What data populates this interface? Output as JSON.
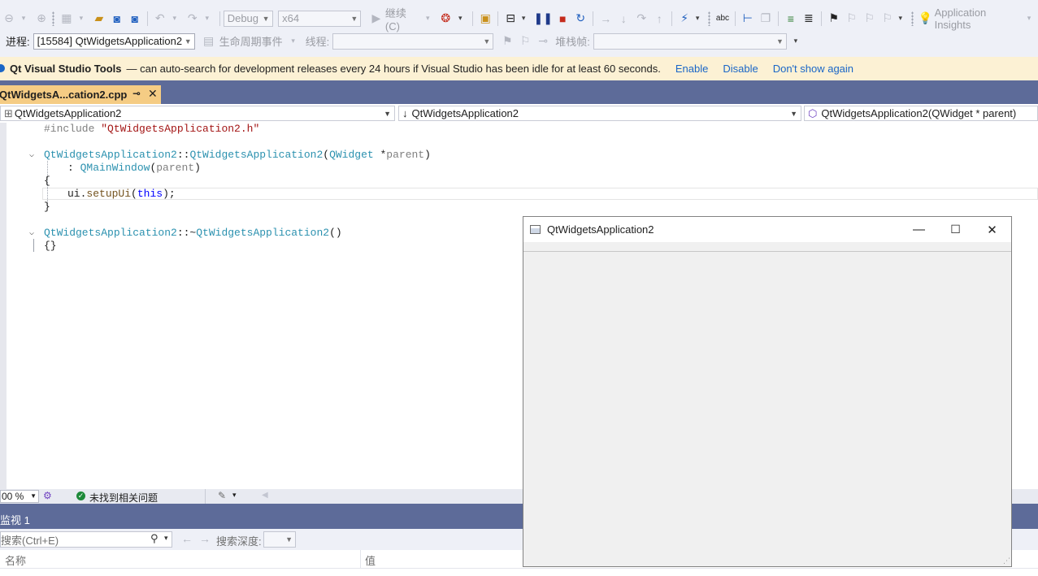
{
  "toolbar": {
    "config": "Debug",
    "platform": "x64",
    "continue_label": "继续(C)",
    "app_insights_label": "Application Insights",
    "process_label": "进程:",
    "process_value": "[15584] QtWidgetsApplication2",
    "lifecycle_label": "生命周期事件",
    "thread_label": "线程:",
    "stackframe_label": "堆栈帧:"
  },
  "infobar": {
    "title": "Qt Visual Studio Tools",
    "message": "— can auto-search for development releases every 24 hours if Visual Studio has been idle for at least 60 seconds.",
    "links": [
      "Enable",
      "Disable",
      "Don't show again"
    ]
  },
  "tab": {
    "label": "QtWidgetsA...cation2.cpp"
  },
  "navbar": {
    "project": "QtWidgetsApplication2",
    "scope": "QtWidgetsApplication2",
    "member": "QtWidgetsApplication2(QWidget * parent)"
  },
  "code": {
    "l1a": "#include ",
    "l1b": "\"QtWidgetsApplication2.h\"",
    "l3a": "QtWidgetsApplication2",
    "l3b": "::",
    "l3c": "QtWidgetsApplication2",
    "l3d": "(",
    "l3e": "QWidget",
    "l3f": " *",
    "l3g": "parent",
    "l3h": ")",
    "l4a": ": ",
    "l4b": "QMainWindow",
    "l4c": "(",
    "l4d": "parent",
    "l4e": ")",
    "l5": "{",
    "l6a": "ui",
    "l6b": ".",
    "l6c": "setupUi",
    "l6d": "(",
    "l6e": "this",
    "l6f": ");",
    "l7": "}",
    "l9a": "QtWidgetsApplication2",
    "l9b": "::~",
    "l9c": "QtWidgetsApplication2",
    "l9d": "()",
    "l10": "{}"
  },
  "status": {
    "zoom": "00 %",
    "issues": "未找到相关问题"
  },
  "watch": {
    "title": "监视 1",
    "search_placeholder": "搜索(Ctrl+E)",
    "depth_label": "搜索深度:",
    "col_name": "名称",
    "col_value": "值"
  },
  "qt_window": {
    "title": "QtWidgetsApplication2"
  }
}
